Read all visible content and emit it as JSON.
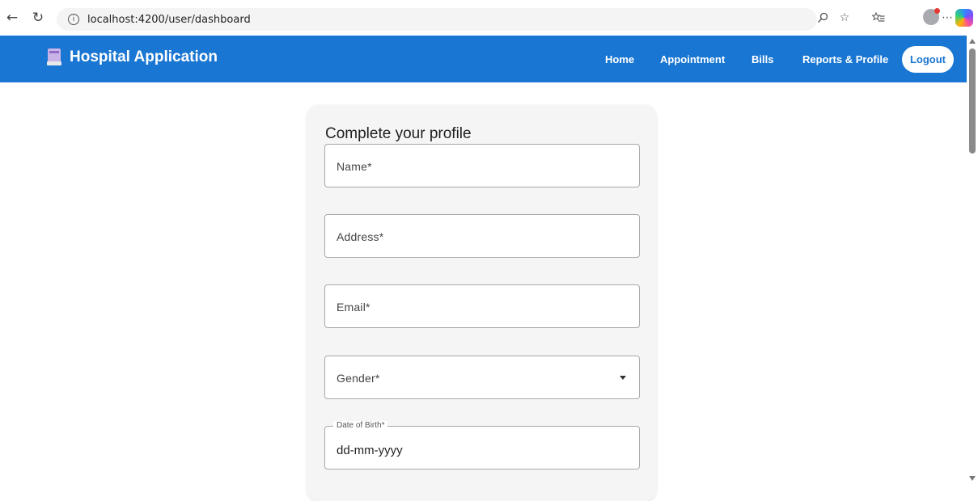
{
  "browser": {
    "url": "localhost:4200/user/dashboard"
  },
  "header": {
    "title": "Hospital Application",
    "nav": [
      {
        "label": "Home"
      },
      {
        "label": "Appointment"
      },
      {
        "label": "Bills"
      },
      {
        "label": "Reports & Profile"
      }
    ],
    "logout_label": "Logout",
    "accent_color": "#1976d2"
  },
  "form": {
    "title": "Complete your profile",
    "fields": {
      "name": {
        "label": "Name*"
      },
      "address": {
        "label": "Address*"
      },
      "email": {
        "label": "Email*"
      },
      "gender": {
        "label": "Gender*"
      },
      "dob": {
        "label": "Date of Birth*",
        "placeholder": "dd-mm-yyyy"
      }
    }
  },
  "icons": {
    "back": "back-arrow-icon",
    "refresh": "refresh-icon",
    "info": "info-icon",
    "read_aloud": "read-aloud-icon",
    "favorite": "star-icon",
    "favorites_bar": "favorites-icon",
    "more": "more-icon",
    "brand": "hospital-icon",
    "dropdown": "chevron-down-icon"
  }
}
